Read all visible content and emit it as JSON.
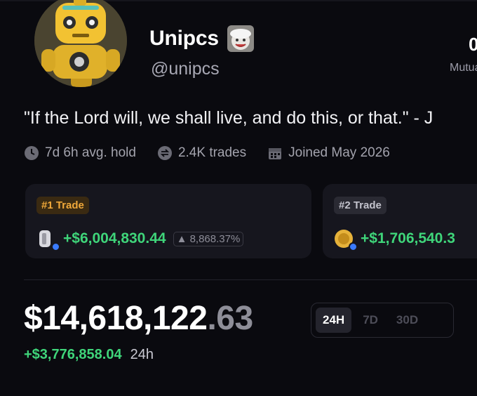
{
  "profile": {
    "name": "Unipcs",
    "handle": "@unipcs",
    "bio": "\"If the Lord will, we shall live, and do this, or that.\" - J",
    "right_stat_value": "0",
    "right_stat_label": "Mutuals"
  },
  "meta": [
    {
      "icon": "clock-icon",
      "text": "7d 6h avg. hold"
    },
    {
      "icon": "swap-icon",
      "text": "2.4K trades"
    },
    {
      "icon": "calendar-icon",
      "text": "Joined May 2026"
    }
  ],
  "top_trades": [
    {
      "rank": "#1 Trade",
      "gain": "+$6,004,830.44",
      "percent": "8,868.37%",
      "token_icon": "white-token-icon"
    },
    {
      "rank": "#2 Trade",
      "gain": "+$1,706,540.3",
      "percent": "",
      "token_icon": "gold-coin-icon"
    }
  ],
  "portfolio": {
    "balance_main": "$14,618,122",
    "balance_cents": ".63",
    "change_value": "+$3,776,858.04",
    "change_period": "24h"
  },
  "ranges": {
    "options": [
      "24H",
      "7D",
      "30D"
    ],
    "selected": "24H"
  },
  "colors": {
    "background": "#0a0a0f",
    "card": "#16161e",
    "positive": "#3fd57a",
    "rank1_accent": "#f0a83a",
    "verified": "#3a7bff"
  }
}
